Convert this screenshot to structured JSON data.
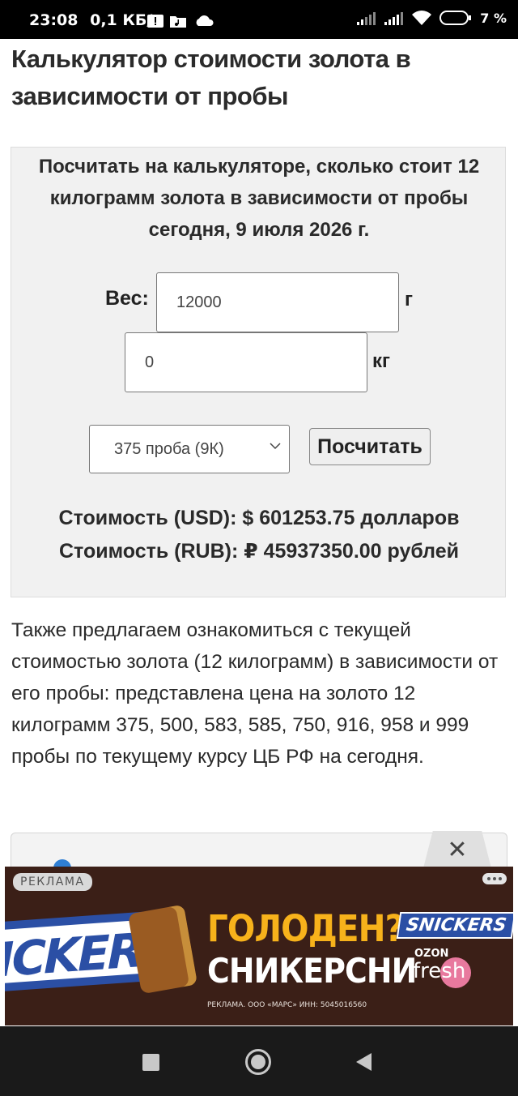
{
  "status_bar": {
    "time": "23:08",
    "network_speed": "0,1 КБ/с",
    "battery": "7 %"
  },
  "page": {
    "title": "Калькулятор стоимости золота в зависимости от пробы"
  },
  "calculator": {
    "heading": "Посчитать на калькуляторе, сколько стоит 12 килограмм золота в зависимости от пробы сегодня, 9 июля 2026 г.",
    "weight_label": "Вес:",
    "grams_value": "12000",
    "grams_unit": "г",
    "kg_value": "0",
    "kg_unit": "кг",
    "purity_selected": "375 проба (9К)",
    "calculate_button": "Посчитать",
    "result_usd": "Стоимость (USD): $ 601253.75 долларов",
    "result_rub": "Стоимость (RUB): ₽ 45937350.00 рублей"
  },
  "description": "Также предлагаем ознакомиться с текущей стоимостью золота (12 килограмм) в зависимости от его пробы: представлена цена на золото 12 килограмм 375, 500, 583, 585, 750, 916, 958 и 999 пробы по текущему курсу ЦБ РФ на сегодня.",
  "ad": {
    "close_symbol": "✕",
    "badge": "РЕКЛАМА",
    "bar_logo": "ICKERS",
    "headline": "ГОЛОДЕН?",
    "subline": "СНИКЕРСНИ",
    "brand": "SNICKERS",
    "ozon": "OZON",
    "fresh": "fresh",
    "legal": "РЕКЛАМА. ООО «МАРС» ИНН: 5045016560",
    "accent_color": "#f7b21b",
    "background_color": "#3b1f17"
  },
  "icons": {
    "nav": [
      "recents-square-icon",
      "home-circle-icon",
      "back-triangle-icon"
    ]
  }
}
